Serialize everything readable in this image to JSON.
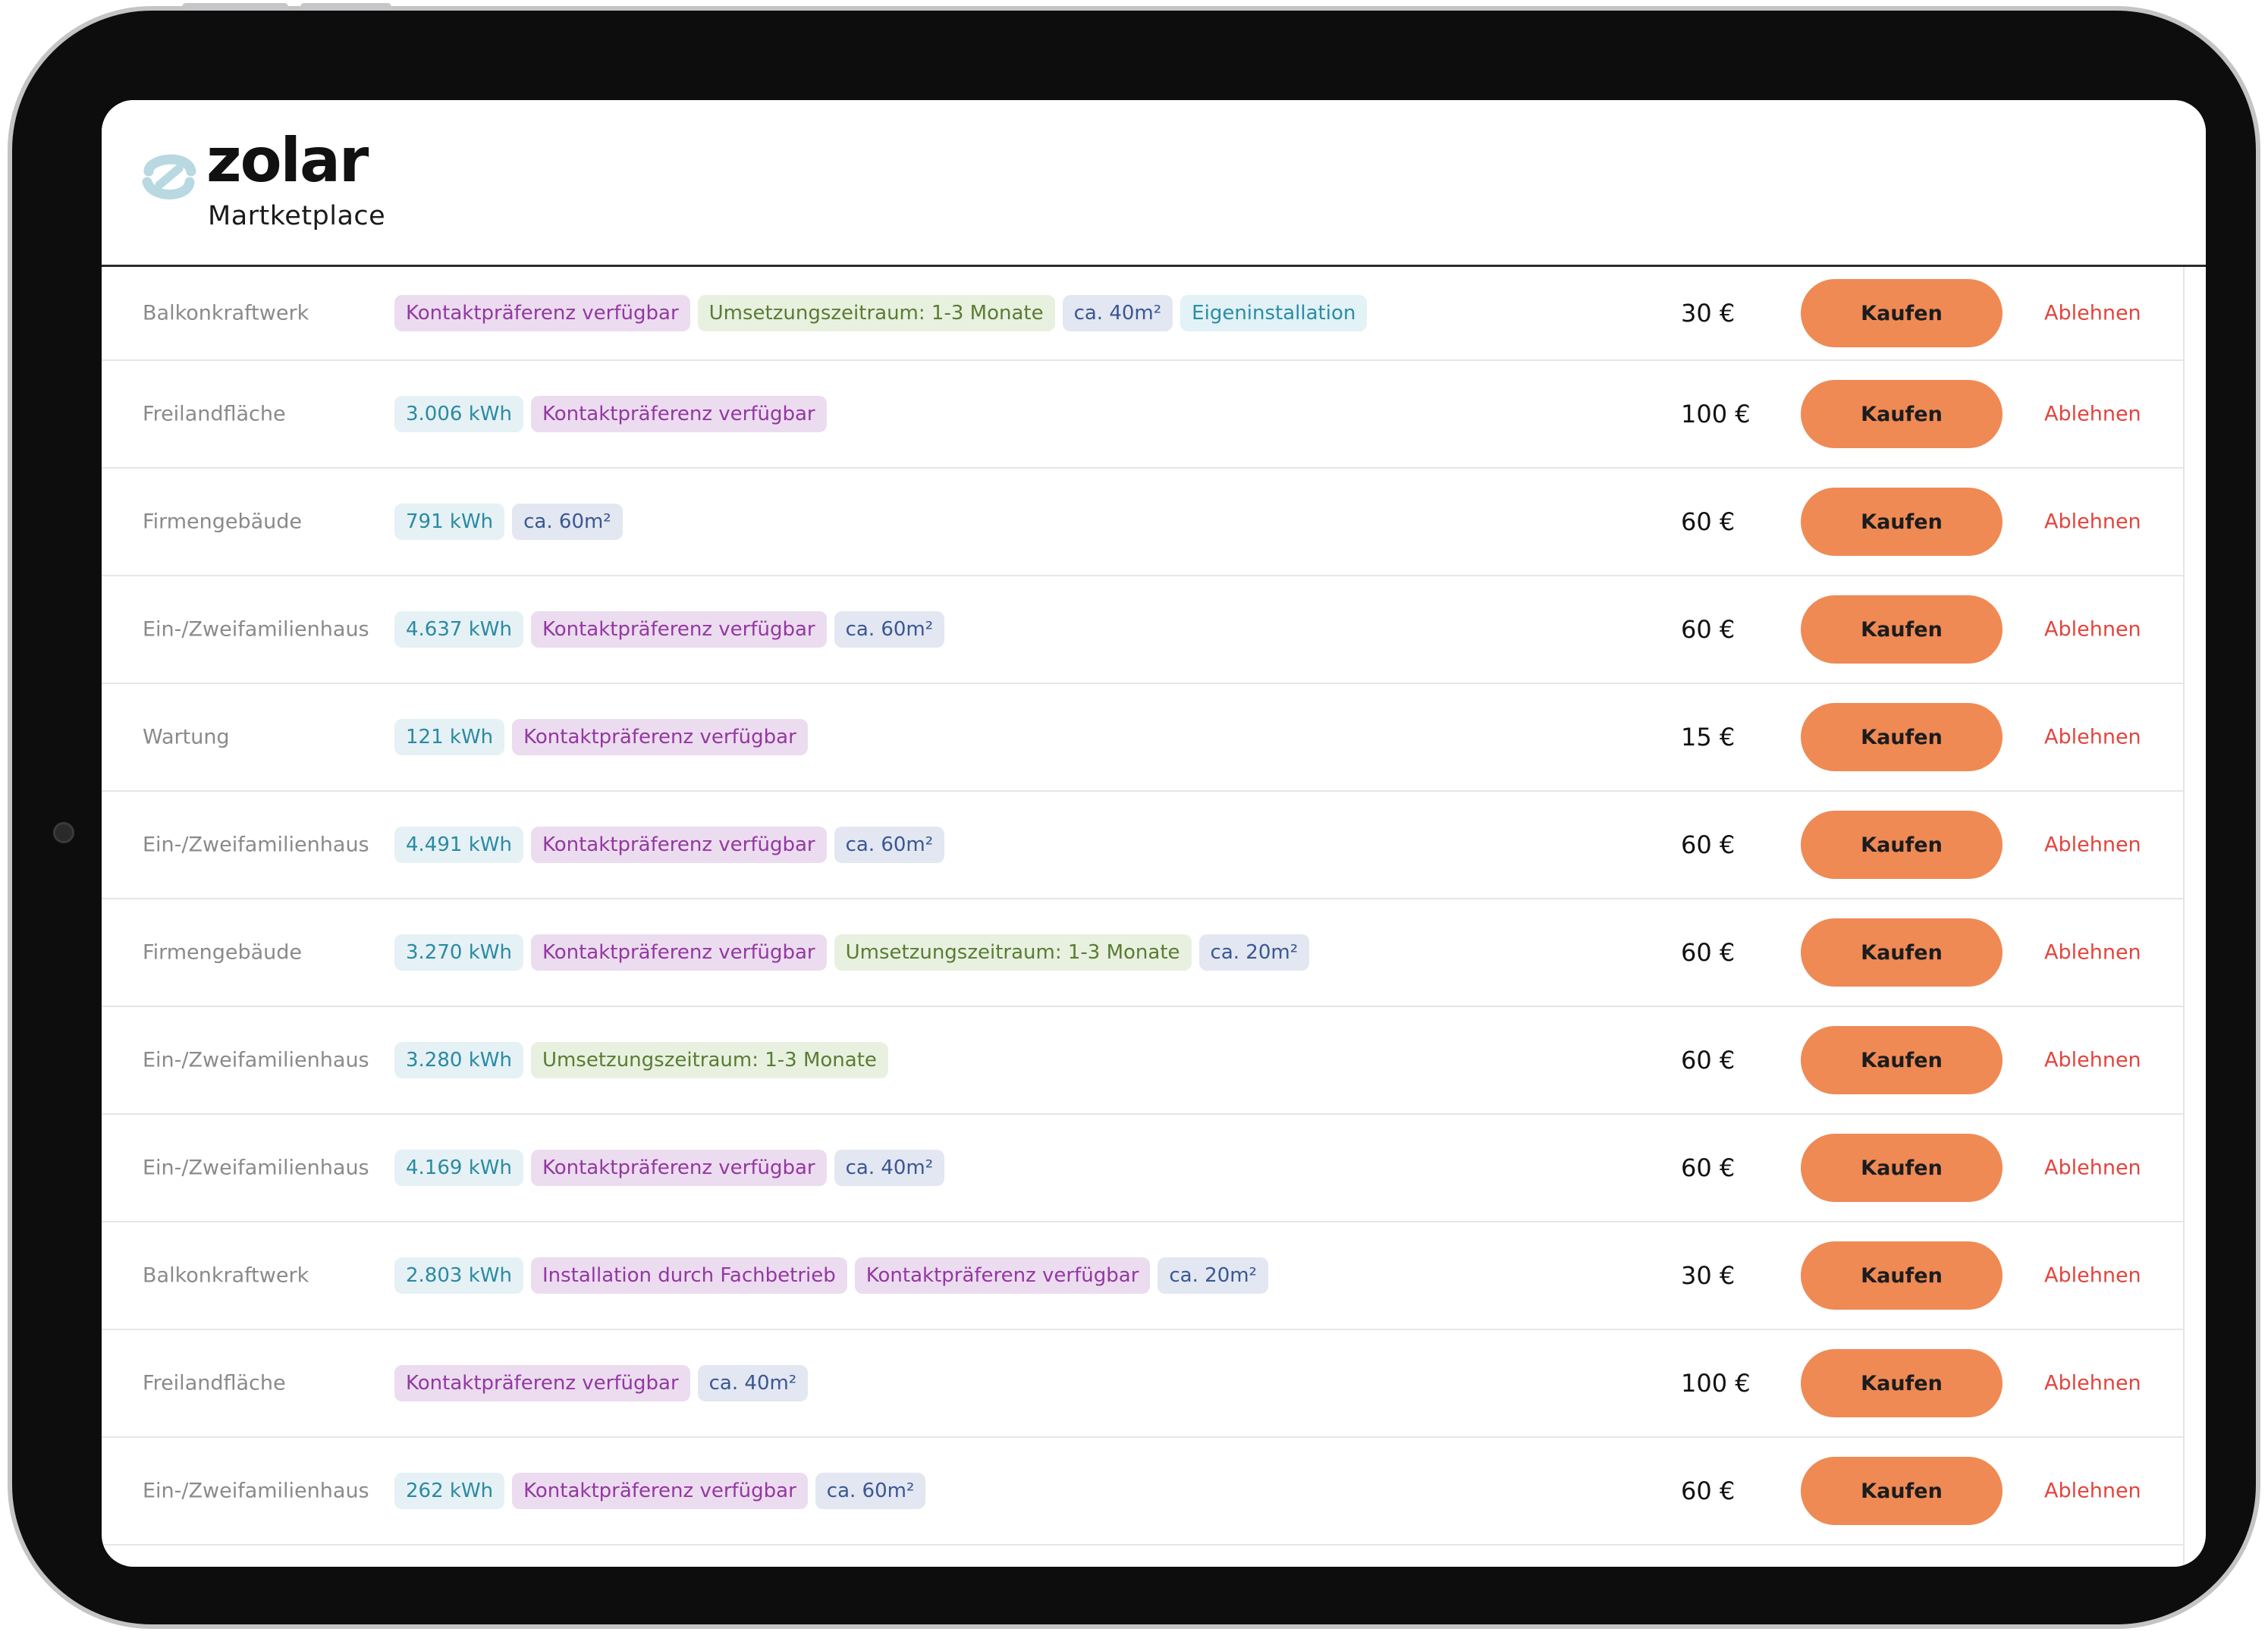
{
  "app": {
    "brand": "zolar",
    "subtitle": "Martketplace"
  },
  "colors": {
    "accent": "#ef8a55",
    "reject": "#e2453e"
  },
  "actions": {
    "buy_label": "Kaufen",
    "reject_label": "Ablehnen"
  },
  "rows": [
    {
      "category": "Balkonkraftwerk",
      "tags": [
        {
          "type": "contact",
          "label": "Kontaktpräferenz verfügbar"
        },
        {
          "type": "time",
          "label": "Umsetzungszeitraum: 1-3 Monate"
        },
        {
          "type": "area",
          "label": "ca. 40m²"
        },
        {
          "type": "self",
          "label": "Eigeninstallation"
        }
      ],
      "price": "30 €"
    },
    {
      "category": "Freilandfläche",
      "tags": [
        {
          "type": "kwh",
          "label": "3.006 kWh"
        },
        {
          "type": "contact",
          "label": "Kontaktpräferenz verfügbar"
        }
      ],
      "price": "100 €"
    },
    {
      "category": "Firmengebäude",
      "tags": [
        {
          "type": "kwh",
          "label": "791 kWh"
        },
        {
          "type": "area",
          "label": "ca. 60m²"
        }
      ],
      "price": "60 €"
    },
    {
      "category": "Ein-/Zweifamilienhaus",
      "tags": [
        {
          "type": "kwh",
          "label": "4.637 kWh"
        },
        {
          "type": "contact",
          "label": "Kontaktpräferenz verfügbar"
        },
        {
          "type": "area",
          "label": "ca. 60m²"
        }
      ],
      "price": "60 €"
    },
    {
      "category": "Wartung",
      "tags": [
        {
          "type": "kwh",
          "label": "121 kWh"
        },
        {
          "type": "contact",
          "label": "Kontaktpräferenz verfügbar"
        }
      ],
      "price": "15 €"
    },
    {
      "category": "Ein-/Zweifamilienhaus",
      "tags": [
        {
          "type": "kwh",
          "label": "4.491 kWh"
        },
        {
          "type": "contact",
          "label": "Kontaktpräferenz verfügbar"
        },
        {
          "type": "area",
          "label": "ca. 60m²"
        }
      ],
      "price": "60 €"
    },
    {
      "category": "Firmengebäude",
      "tags": [
        {
          "type": "kwh",
          "label": "3.270 kWh"
        },
        {
          "type": "contact",
          "label": "Kontaktpräferenz verfügbar"
        },
        {
          "type": "time",
          "label": "Umsetzungszeitraum: 1-3 Monate"
        },
        {
          "type": "area",
          "label": "ca. 20m²"
        }
      ],
      "price": "60 €"
    },
    {
      "category": "Ein-/Zweifamilienhaus",
      "tags": [
        {
          "type": "kwh",
          "label": "3.280 kWh"
        },
        {
          "type": "time",
          "label": "Umsetzungszeitraum: 1-3 Monate"
        }
      ],
      "price": "60 €"
    },
    {
      "category": "Ein-/Zweifamilienhaus",
      "tags": [
        {
          "type": "kwh",
          "label": "4.169 kWh"
        },
        {
          "type": "contact",
          "label": "Kontaktpräferenz verfügbar"
        },
        {
          "type": "area",
          "label": "ca. 40m²"
        }
      ],
      "price": "60 €"
    },
    {
      "category": "Balkonkraftwerk",
      "tags": [
        {
          "type": "kwh",
          "label": "2.803 kWh"
        },
        {
          "type": "install",
          "label": "Installation durch Fachbetrieb"
        },
        {
          "type": "contact",
          "label": "Kontaktpräferenz verfügbar"
        },
        {
          "type": "area",
          "label": "ca. 20m²"
        }
      ],
      "price": "30 €"
    },
    {
      "category": "Freilandfläche",
      "tags": [
        {
          "type": "contact",
          "label": "Kontaktpräferenz verfügbar"
        },
        {
          "type": "area",
          "label": "ca. 40m²"
        }
      ],
      "price": "100 €"
    },
    {
      "category": "Ein-/Zweifamilienhaus",
      "tags": [
        {
          "type": "kwh",
          "label": "262 kWh"
        },
        {
          "type": "contact",
          "label": "Kontaktpräferenz verfügbar"
        },
        {
          "type": "area",
          "label": "ca. 60m²"
        }
      ],
      "price": "60 €"
    }
  ]
}
